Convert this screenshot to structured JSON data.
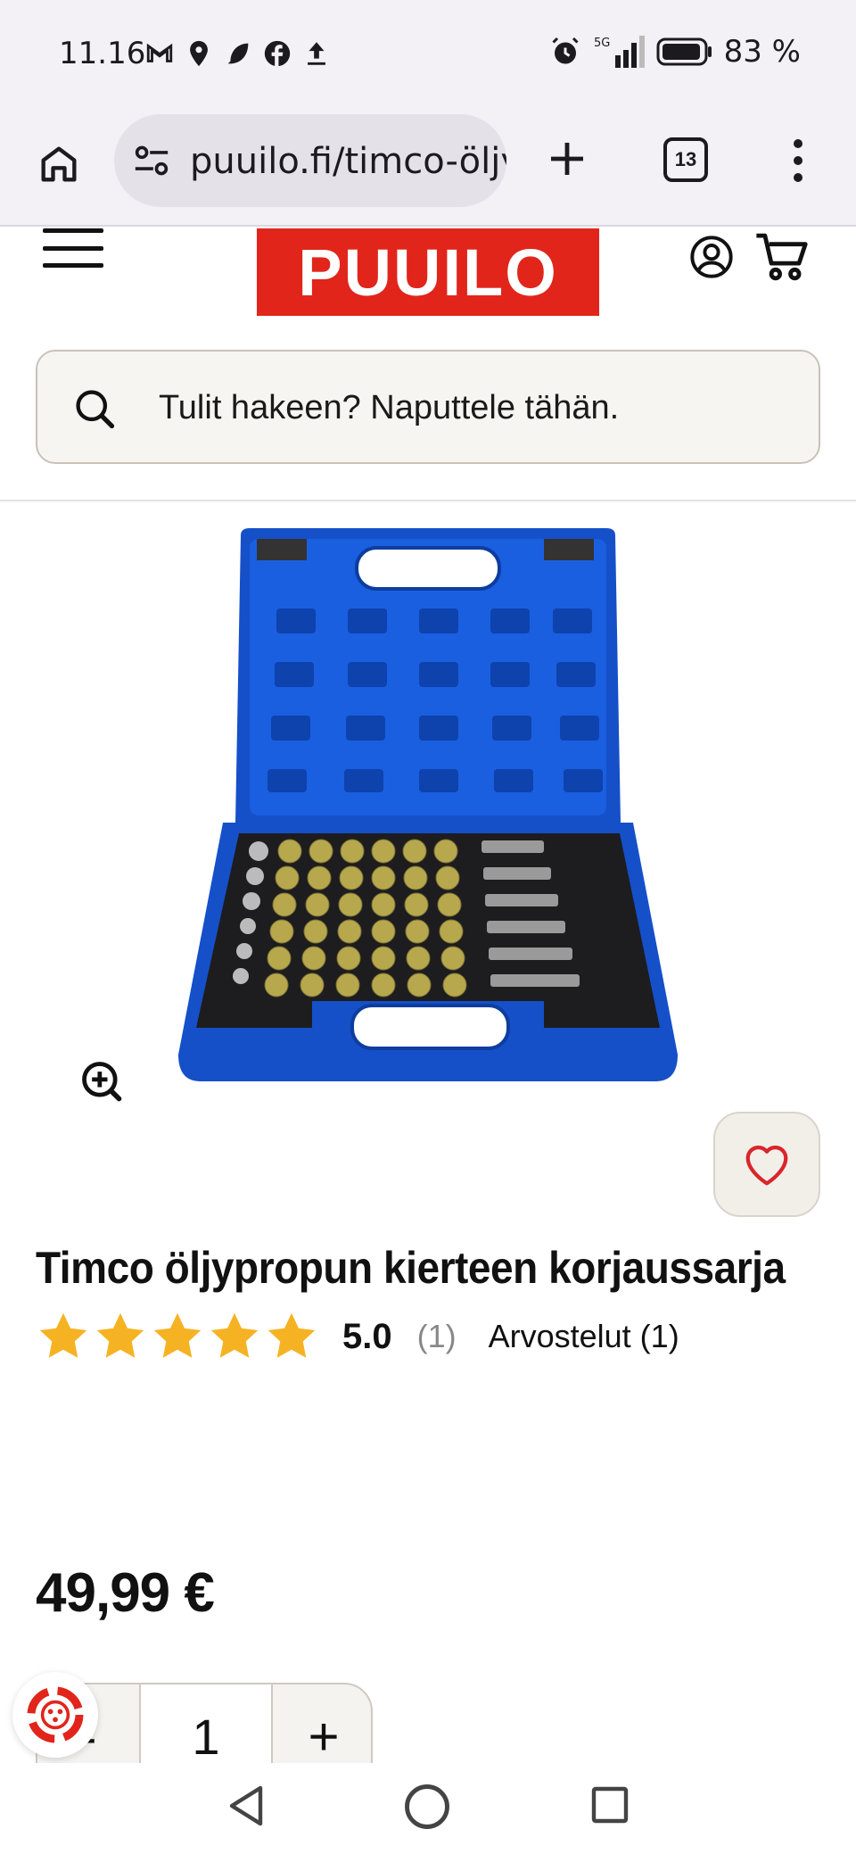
{
  "status_bar": {
    "time": "11.16",
    "battery_percent": "83 %",
    "network": "5G",
    "icons_left": [
      "gmail-icon",
      "maps-icon",
      "feather-icon",
      "facebook-icon",
      "upload-icon"
    ],
    "icons_right": [
      "alarm-icon",
      "signal-icon",
      "battery-icon"
    ]
  },
  "browser": {
    "url": "puuilo.fi/timco-öljypropun-kierteen-korjaussarja",
    "tab_count": "13"
  },
  "site": {
    "logo_text": "PUUILO",
    "brand_color": "#e1251b",
    "search_placeholder": "Tulit hakeen? Naputtele tähän."
  },
  "product": {
    "title": "Timco öljypropun kierteen korjaussarja",
    "rating": 5.0,
    "rating_text": "5.0",
    "rating_count_text": "(1)",
    "reviews_label": "Arvostelut (1)",
    "stars_filled": 5,
    "star_color": "#f5b324",
    "price": "49,99 €",
    "quantity": "1",
    "minus_label": "-",
    "plus_label": "+"
  }
}
